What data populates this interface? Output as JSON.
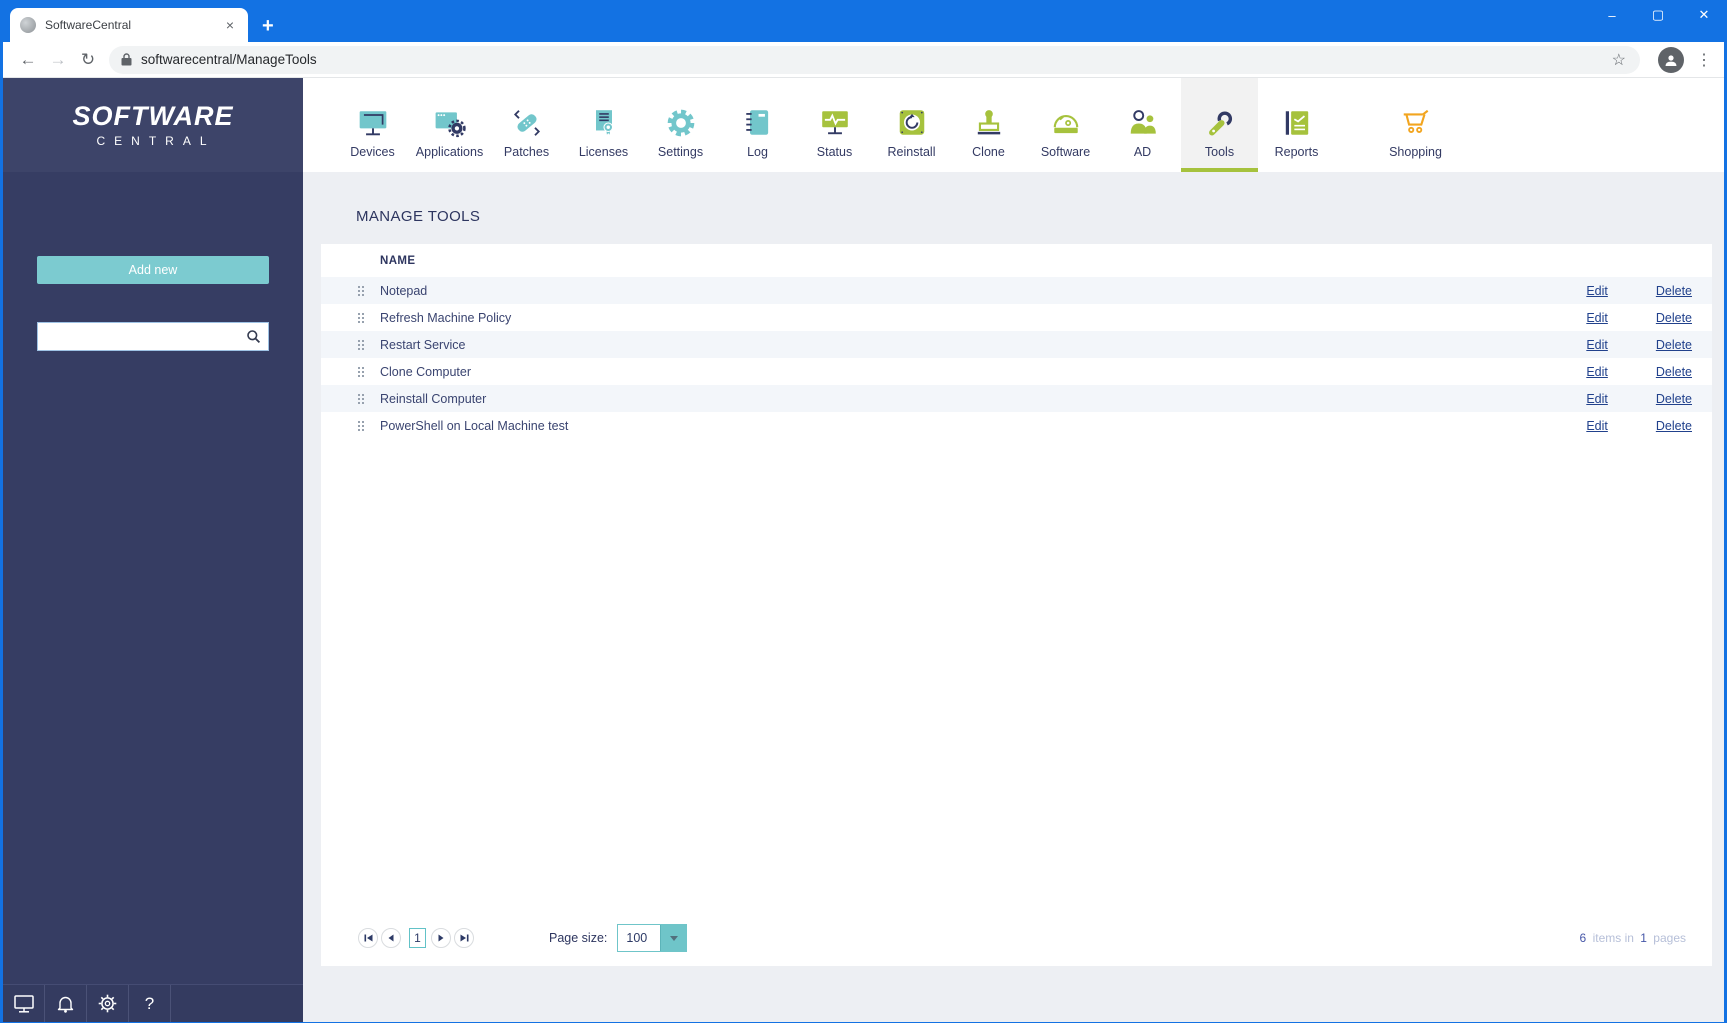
{
  "browser": {
    "tab_title": "SoftwareCentral",
    "url": "softwarecentral/ManageTools",
    "close_tab_glyph": "×",
    "new_tab_glyph": "+",
    "back_glyph": "←",
    "forward_glyph": "→",
    "reload_glyph": "↻",
    "star_glyph": "☆",
    "menu_glyph": "⋮",
    "minimize_glyph": "–",
    "maximize_glyph": "▢",
    "close_glyph": "✕"
  },
  "sidebar": {
    "logo_top": "SOFTWARE",
    "logo_bottom": "CENTRAL",
    "add_new": "Add new",
    "help_glyph": "?"
  },
  "nav": {
    "items": [
      {
        "label": "Devices"
      },
      {
        "label": "Applications"
      },
      {
        "label": "Patches"
      },
      {
        "label": "Licenses"
      },
      {
        "label": "Settings"
      },
      {
        "label": "Log"
      },
      {
        "label": "Status"
      },
      {
        "label": "Reinstall"
      },
      {
        "label": "Clone"
      },
      {
        "label": "Software"
      },
      {
        "label": "AD"
      },
      {
        "label": "Tools",
        "active": true
      },
      {
        "label": "Reports"
      },
      {
        "label": "Shopping"
      }
    ]
  },
  "page": {
    "title": "MANAGE TOOLS"
  },
  "table": {
    "name_header": "NAME",
    "rows": [
      {
        "name": "Notepad"
      },
      {
        "name": "Refresh Machine Policy"
      },
      {
        "name": "Restart Service"
      },
      {
        "name": "Clone Computer"
      },
      {
        "name": "Reinstall Computer"
      },
      {
        "name": "PowerShell on Local Machine test"
      }
    ],
    "actions": {
      "edit": "Edit",
      "delete": "Delete"
    }
  },
  "pagination": {
    "page": "1",
    "page_size_label": "Page size:",
    "page_size": "100",
    "items_count": "6",
    "items_text": "items in",
    "pages_count": "1",
    "pages_text": "pages"
  },
  "colors": {
    "titlebar_blue": "#1372e3",
    "sidebar_navy": "#363d63",
    "accent_teal": "#72c6cb",
    "accent_green": "#a6c23d",
    "accent_orange": "#f2a51f",
    "icon_navy": "#323a64",
    "link_blue": "#21418c"
  }
}
